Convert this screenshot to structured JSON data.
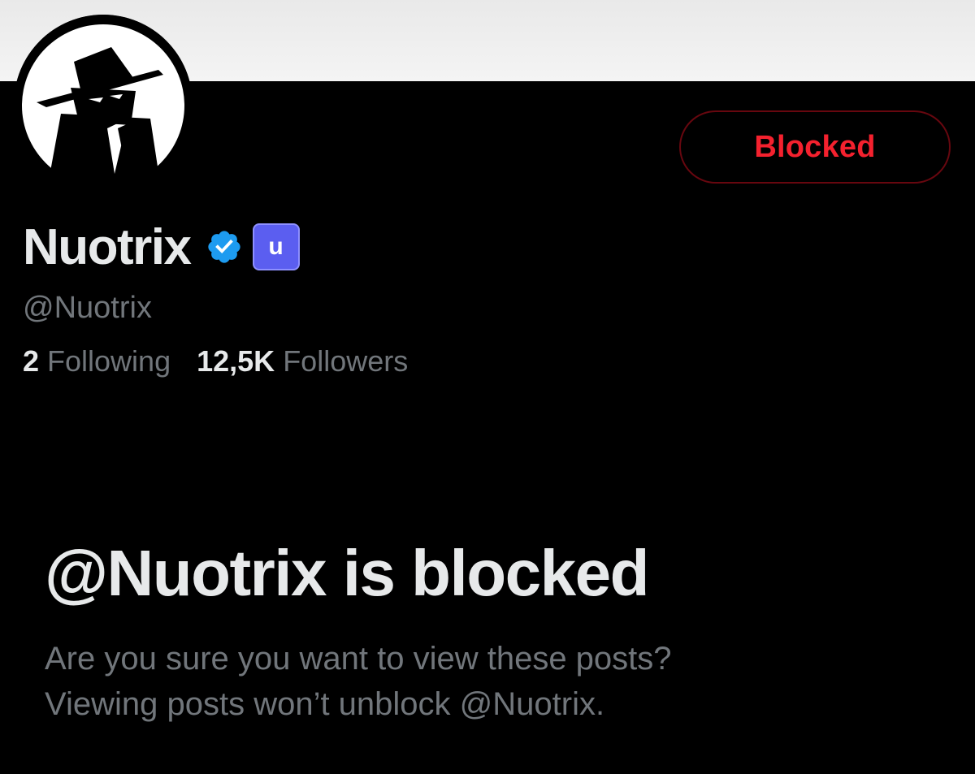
{
  "profile": {
    "display_name": "Nuotrix",
    "handle": "@Nuotrix",
    "affiliate_badge_letter": "u",
    "avatar_icon": "spy-hat-figure-icon",
    "verified_icon": "verified-badge-icon"
  },
  "actions": {
    "blocked_label": "Blocked"
  },
  "stats": {
    "following_count": "2",
    "following_label": "Following",
    "followers_count": "12,5K",
    "followers_label": "Followers"
  },
  "blocked_notice": {
    "title": "@Nuotrix is blocked",
    "line1": "Are you sure you want to view these posts?",
    "line2": "Viewing posts won’t unblock @Nuotrix."
  },
  "colors": {
    "background": "#000000",
    "banner": "#efefef",
    "primary_text": "#e7e9ea",
    "secondary_text": "#71767b",
    "blocked_red": "#f4212e",
    "blocked_border": "#67070f",
    "verified_blue": "#1d9bf0",
    "affiliate_badge": "#5b5ef0"
  }
}
